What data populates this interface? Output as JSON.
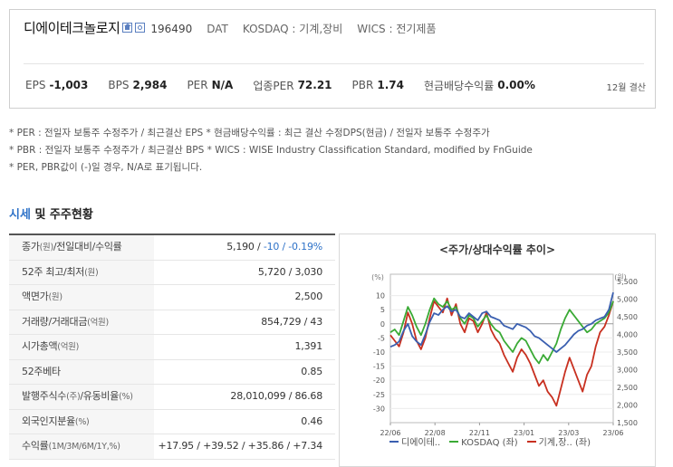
{
  "header": {
    "company": "디에이테크놀로지",
    "code": "196490",
    "tag": "DAT",
    "market": "KOSDAQ : 기계,장비",
    "wics": "WICS : 전기제품",
    "ratios": [
      {
        "label": "EPS",
        "value": "-1,003"
      },
      {
        "label": "BPS",
        "value": "2,984"
      },
      {
        "label": "PER",
        "value": "N/A"
      },
      {
        "label": "업종PER",
        "value": "72.21"
      },
      {
        "label": "PBR",
        "value": "1.74"
      },
      {
        "label": "현금배당수익률",
        "value": "0.00%"
      }
    ],
    "settlement": "12월 결산"
  },
  "notes": [
    "* PER : 전일자 보통주 수정주가 / 최근결산 EPS * 현금배당수익률 : 최근 결산 수정DPS(현금) / 전일자 보통주 수정주가",
    "* PBR : 전일자 보통주 수정주가 / 최근결산 BPS * WICS : WISE Industry Classification Standard, modified by FnGuide",
    "* PER, PBR값이 (-)일 경우, N/A로 표기됩니다."
  ],
  "section": {
    "title_blue": "시세",
    "title_rest": " 및 주주현황"
  },
  "table": {
    "r0": {
      "k": "종가",
      "ku": "(원)",
      "k2": "/전일대비/수익률",
      "v1": "5,190 / ",
      "v2": "-10 / -0.19%"
    },
    "r1": {
      "k": "52주 최고/최저",
      "ku": "(원)",
      "v": "5,720 / 3,030"
    },
    "r2": {
      "k": "액면가",
      "ku": "(원)",
      "v": "2,500"
    },
    "r3": {
      "k": "거래량/거래대금",
      "ku": "(억원)",
      "v": "854,729 / 43"
    },
    "r4": {
      "k": "시가총액",
      "ku": "(억원)",
      "v": "1,391"
    },
    "r5": {
      "k": "52주베타",
      "ku": "",
      "v": "0.85"
    },
    "r6": {
      "k": "발행주식수",
      "ku": "(주)",
      "k2": "/유동비율",
      "ku2": "(%)",
      "v": "28,010,099 / 86.68"
    },
    "r7": {
      "k": "외국인지분율",
      "ku": "(%)",
      "v": "0.46"
    },
    "r8": {
      "k": "수익률",
      "ku": "(1M/3M/6M/1Y,%)",
      "v": "+17.95 / +39.52 / +35.86 / +7.34"
    }
  },
  "chart_title": "<주가/상대수익률 추이>",
  "colors": {
    "accent_blue": "#2e72c8",
    "up_red": "#e03030",
    "series_blue": "#3a5fb0",
    "series_green": "#3aaa35",
    "series_red": "#c83020"
  },
  "chart_data": {
    "type": "line",
    "left_axis_unit": "(%)",
    "right_axis_unit": "(원)",
    "x_labels": [
      "22/06",
      "22/08",
      "22/11",
      "23/01",
      "23/03",
      "23/06"
    ],
    "y_left_ticks": [
      10,
      5,
      0,
      -5,
      -10,
      -15,
      -20,
      -25,
      -30
    ],
    "y_left_range": [
      -35,
      15
    ],
    "y_right_ticks": [
      5500,
      5000,
      4500,
      4000,
      3500,
      3000,
      2500,
      2000,
      1500
    ],
    "y_right_range": [
      1500,
      5500
    ],
    "series": [
      {
        "name": "디에이테..",
        "axis": "right",
        "color": "#3a5fb0",
        "values": [
          3650,
          3700,
          3800,
          4100,
          4300,
          3950,
          3800,
          3700,
          4000,
          4350,
          4600,
          4550,
          4700,
          4800,
          4650,
          4700,
          4500,
          4450,
          4600,
          4500,
          4400,
          4600,
          4650,
          4500,
          4450,
          4400,
          4250,
          4200,
          4150,
          4300,
          4250,
          4200,
          4100,
          3950,
          3900,
          3800,
          3700,
          3600,
          3500,
          3600,
          3700,
          3850,
          4000,
          4100,
          4150,
          4250,
          4300,
          4400,
          4450,
          4500,
          4700,
          5190
        ]
      },
      {
        "name": "KOSDAQ (좌)",
        "axis": "left",
        "color": "#3aaa35",
        "values": [
          -3,
          -2,
          -4,
          1,
          6,
          3,
          -1,
          -4,
          0,
          5,
          9,
          7,
          6,
          8,
          5,
          6,
          2,
          0,
          3,
          2,
          -1,
          1,
          3,
          0,
          -2,
          -3,
          -6,
          -8,
          -10,
          -7,
          -5,
          -6,
          -9,
          -12,
          -14,
          -11,
          -13,
          -10,
          -7,
          -2,
          2,
          5,
          3,
          1,
          -1,
          -3,
          -2,
          0,
          1,
          2,
          4,
          8
        ]
      },
      {
        "name": "기계,장.. (좌)",
        "axis": "left",
        "color": "#c83020",
        "values": [
          -4,
          -6,
          -8,
          -3,
          4,
          0,
          -6,
          -9,
          -5,
          2,
          8,
          6,
          4,
          9,
          3,
          7,
          0,
          -3,
          2,
          1,
          -3,
          0,
          4,
          -2,
          -5,
          -7,
          -11,
          -14,
          -17,
          -12,
          -9,
          -11,
          -14,
          -18,
          -22,
          -20,
          -24,
          -26,
          -29,
          -23,
          -17,
          -12,
          -16,
          -20,
          -24,
          -18,
          -15,
          -8,
          -3,
          -1,
          3,
          8
        ]
      }
    ]
  }
}
